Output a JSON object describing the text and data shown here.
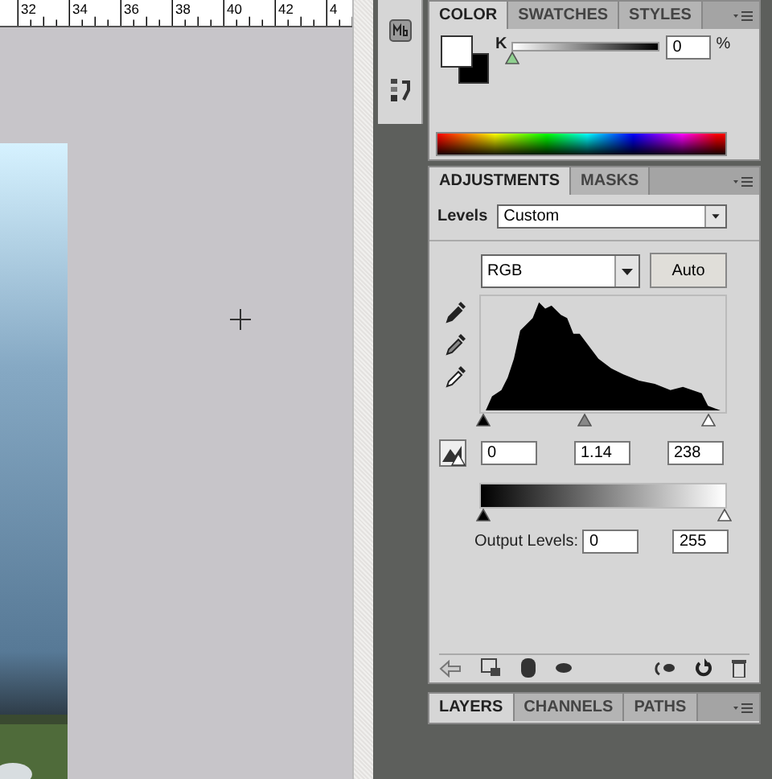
{
  "ruler": {
    "labels": [
      "32",
      "34",
      "36",
      "38",
      "40",
      "42",
      "4"
    ]
  },
  "color_panel": {
    "tabs": [
      {
        "label": "COLOR",
        "selected": true
      },
      {
        "label": "SWATCHES",
        "selected": false
      },
      {
        "label": "STYLES",
        "selected": false
      }
    ],
    "channel": "K",
    "level": 0,
    "value": "0",
    "unit": "%"
  },
  "adjustments_panel": {
    "tabs": [
      {
        "label": "ADJUSTMENTS",
        "selected": true
      },
      {
        "label": "MASKS",
        "selected": false
      }
    ],
    "preset_label": "Levels",
    "preset": "Custom",
    "channel": "RGB",
    "auto_button": "Auto",
    "input_values": [
      {
        "value": "0",
        "level": 0
      },
      {
        "value": "1.14",
        "level": 0.42
      },
      {
        "value": "238",
        "level": 0.93
      }
    ],
    "output_label": "Output Levels:",
    "output_values": [
      {
        "value": "0",
        "level": 0
      },
      {
        "value": "255",
        "level": 1
      }
    ]
  },
  "layers_panel": {
    "tabs": [
      {
        "label": "LAYERS",
        "selected": true
      },
      {
        "label": "CHANNELS",
        "selected": false
      },
      {
        "label": "PATHS",
        "selected": false
      }
    ]
  }
}
